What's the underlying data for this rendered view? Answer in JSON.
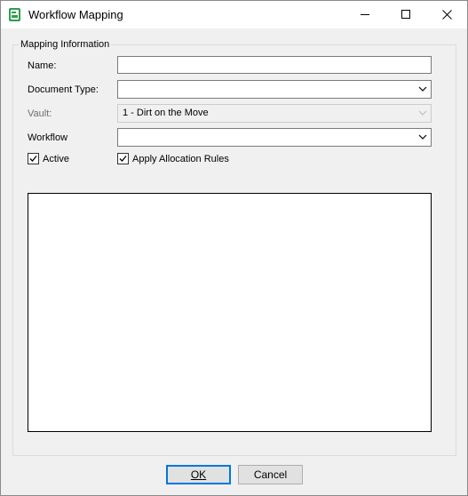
{
  "window": {
    "title": "Workflow Mapping",
    "icon": "workflow-app-icon",
    "controls": {
      "minimize": "minimize-icon",
      "maximize": "maximize-icon",
      "close": "close-icon"
    }
  },
  "group": {
    "legend": "Mapping Information"
  },
  "fields": {
    "name_label": "Name:",
    "name_value": "",
    "document_type_label": "Document Type:",
    "document_type_value": "",
    "vault_label": "Vault:",
    "vault_value": "1 - Dirt on the Move",
    "workflow_label": "Workflow",
    "workflow_value": ""
  },
  "checkboxes": {
    "active": {
      "label": "Active",
      "checked": true
    },
    "apply_allocation": {
      "label": "Apply Allocation Rules",
      "checked": true
    }
  },
  "buttons": {
    "ok": "OK",
    "cancel": "Cancel"
  },
  "colors": {
    "accent": "#0078d7",
    "icon_green": "#2e9e4f"
  }
}
